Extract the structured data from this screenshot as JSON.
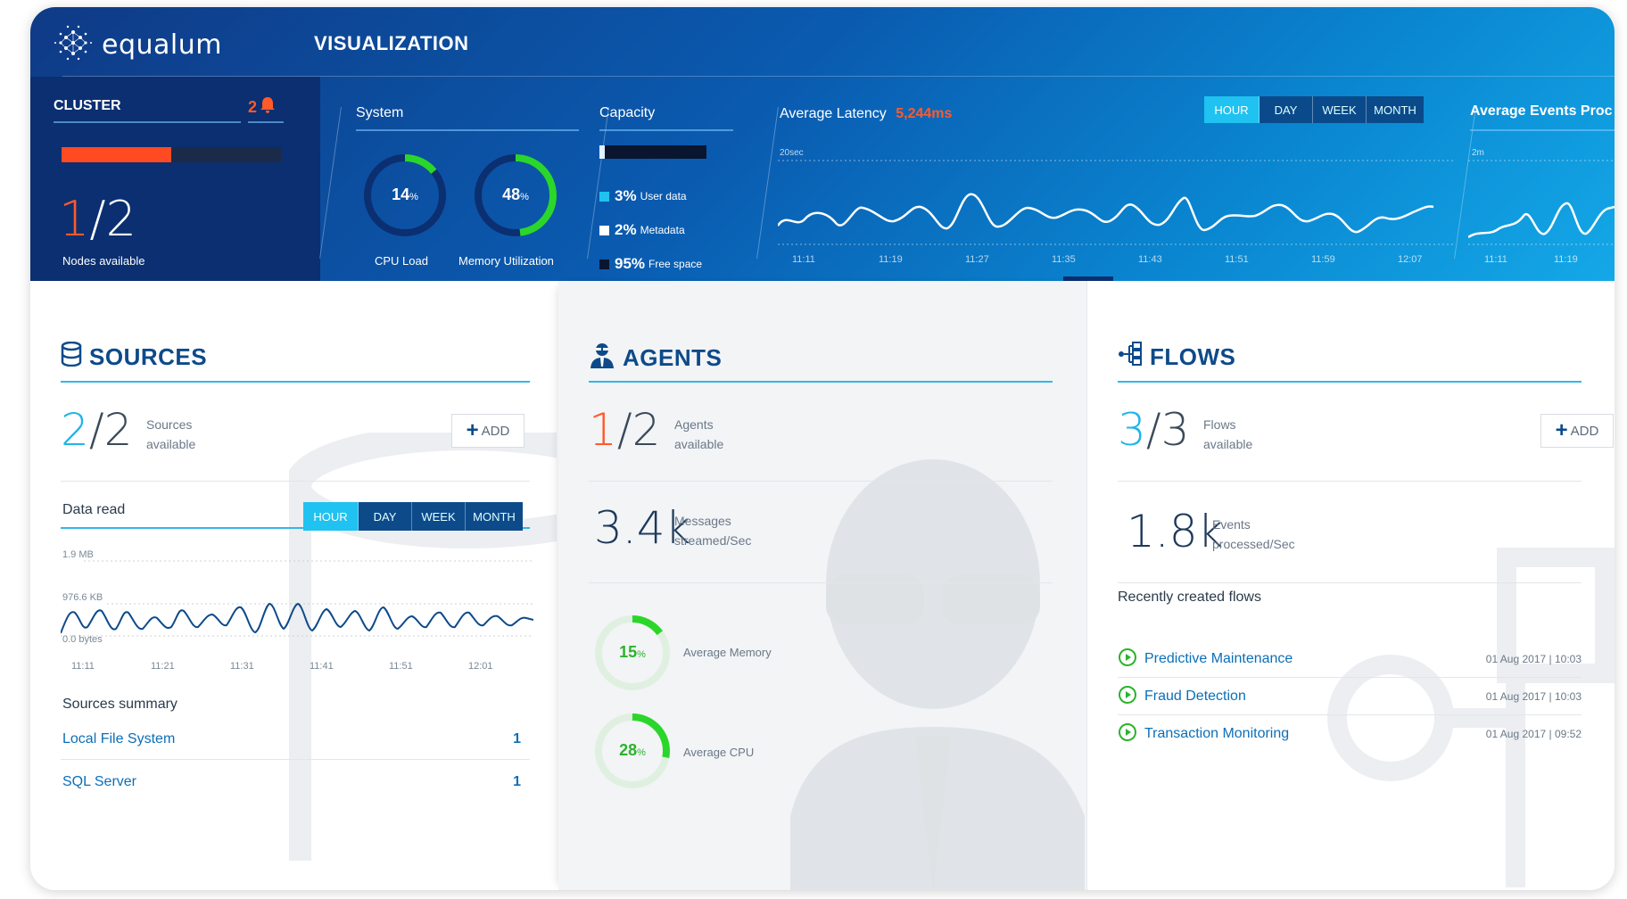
{
  "app": {
    "name": "equalum",
    "page_title": "VISUALIZATION"
  },
  "cluster": {
    "title": "CLUSTER",
    "alert_count": "2",
    "nodes_available": "1",
    "nodes_total": "2",
    "caption": "Nodes available",
    "bar_fraction": 0.5
  },
  "system": {
    "title": "System",
    "cpu": {
      "value": "14",
      "unit": "%",
      "label": "CPU Load",
      "fraction": 0.14
    },
    "memory": {
      "value": "48",
      "unit": "%",
      "label": "Memory Utilization",
      "fraction": 0.48
    }
  },
  "capacity": {
    "title": "Capacity",
    "items": [
      {
        "pct": "3%",
        "label": "User data",
        "color": "#1fc2f0"
      },
      {
        "pct": "2%",
        "label": "Metadata",
        "color": "#ffffff"
      },
      {
        "pct": "95%",
        "label": "Free space",
        "color": "#0a1530"
      }
    ]
  },
  "latency": {
    "title": "Average Latency",
    "value": "5,244ms",
    "scale": "20sec",
    "times": [
      "11:11",
      "11:19",
      "11:27",
      "11:35",
      "11:43",
      "11:51",
      "11:59",
      "12:07"
    ],
    "ranges": [
      "HOUR",
      "DAY",
      "WEEK",
      "MONTH"
    ],
    "active_range": "HOUR"
  },
  "events": {
    "title": "Average Events Proc",
    "scale": "2m",
    "times": [
      "11:11",
      "11:19"
    ]
  },
  "sources": {
    "title": "SOURCES",
    "available": "2",
    "total": "2",
    "caption_1": "Sources",
    "caption_2": "available",
    "add_label": "ADD",
    "data_read_label": "Data read",
    "ranges": [
      "HOUR",
      "DAY",
      "WEEK",
      "MONTH"
    ],
    "y_labels": [
      "1.9 MB",
      "976.6 KB",
      "0.0 bytes"
    ],
    "times": [
      "11:11",
      "11:21",
      "11:31",
      "11:41",
      "11:51",
      "12:01"
    ],
    "summary_title": "Sources summary",
    "summary": [
      {
        "name": "Local File System",
        "count": "1"
      },
      {
        "name": "SQL Server",
        "count": "1"
      }
    ]
  },
  "agents": {
    "title": "AGENTS",
    "available": "1",
    "total": "2",
    "caption_1": "Agents",
    "caption_2": "available",
    "messages_value": "3.4k",
    "messages_caption_1": "Messages",
    "messages_caption_2": "streamed/Sec",
    "avg_memory": {
      "value": "15",
      "unit": "%",
      "label": "Average Memory",
      "fraction": 0.15
    },
    "avg_cpu": {
      "value": "28",
      "unit": "%",
      "label": "Average CPU",
      "fraction": 0.28
    }
  },
  "flows": {
    "title": "FLOWS",
    "available": "3",
    "total": "3",
    "caption_1": "Flows",
    "caption_2": "available",
    "add_label": "ADD",
    "events_value": "1.8k",
    "events_caption_1": "Events",
    "events_caption_2": "processed/Sec",
    "recent_title": "Recently created flows",
    "recent": [
      {
        "name": "Predictive Maintenance",
        "date": "01 Aug 2017 | 10:03"
      },
      {
        "name": "Fraud Detection",
        "date": "01 Aug 2017 | 10:03"
      },
      {
        "name": "Transaction Monitoring",
        "date": "01 Aug 2017 | 09:52"
      }
    ]
  },
  "colors": {
    "accent": "#1fc2f0",
    "alert": "#ff4a22",
    "gauge": "#2bd62b",
    "brand": "#0d4a8a"
  }
}
